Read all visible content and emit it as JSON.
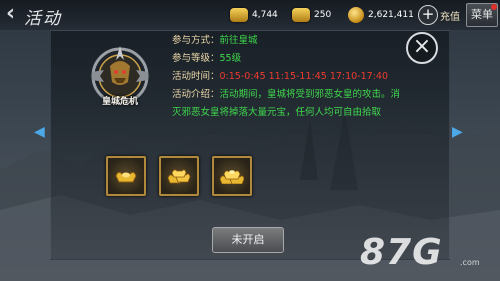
{
  "topbar": {
    "title": "活动",
    "resources": [
      {
        "name": "gold-ingot-icon",
        "value": "4,744"
      },
      {
        "name": "gold-stack-icon",
        "value": "250"
      },
      {
        "name": "coin-icon",
        "value": "2,621,411"
      }
    ],
    "recharge_label": "充值",
    "menu_label": "菜单"
  },
  "panel": {
    "emblem_label": "皇城危机",
    "rows": [
      {
        "label": "参与方式：",
        "value": "前往皇城"
      },
      {
        "label": "参与等级：",
        "value": "55级"
      },
      {
        "label": "活动时间：",
        "value": "0:15-0:45 11:15-11:45 17:10-17:40"
      },
      {
        "label": "活动介绍：",
        "value": "活动期间，皇城将受到邪恶女皇的攻击。消灭邪恶女皇将掉落大量元宝，任何人均可自由拾取"
      }
    ],
    "rewards": [
      "small-ingot-icon",
      "ingot-pile-icon",
      "large-ingot-pile-icon"
    ],
    "action_label": "未开启"
  },
  "watermark": {
    "text": "87G",
    "sub": ".com"
  },
  "colors": {
    "label": "#ecd8a8",
    "value": "#3fd84c",
    "time": "#ee3b2e"
  }
}
